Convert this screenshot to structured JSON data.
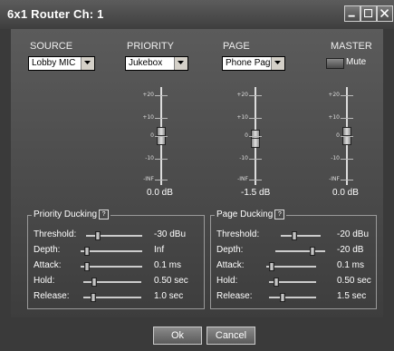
{
  "window": {
    "title": "6x1 Router   Ch: 1"
  },
  "sections": {
    "source": {
      "label": "SOURCE",
      "value": "Lobby MIC"
    },
    "priority": {
      "label": "PRIORITY",
      "value": "Jukebox"
    },
    "page": {
      "label": "PAGE",
      "value": "Phone Page"
    },
    "master": {
      "label": "MASTER",
      "mute_label": "Mute"
    }
  },
  "fader_scale": [
    "+20",
    "+10",
    "0",
    "-10",
    "-INF"
  ],
  "faders": {
    "priority": {
      "value_text": "0.0 dB",
      "db": 0.0
    },
    "page": {
      "value_text": "-1.5 dB",
      "db": -1.5
    },
    "master": {
      "value_text": "0.0 dB",
      "db": 0.0
    }
  },
  "priority_ducking": {
    "title": "Priority Ducking",
    "help_glyph": "?",
    "params": [
      {
        "label": "Threshold:",
        "value": "-30 dBu"
      },
      {
        "label": "Depth:",
        "value": "Inf"
      },
      {
        "label": "Attack:",
        "value": "0.1 ms"
      },
      {
        "label": "Hold:",
        "value": "0.50 sec"
      },
      {
        "label": "Release:",
        "value": "1.0 sec"
      }
    ]
  },
  "page_ducking": {
    "title": "Page Ducking",
    "help_glyph": "?",
    "params": [
      {
        "label": "Threshold:",
        "value": "-20 dBu"
      },
      {
        "label": "Depth:",
        "value": "-20 dB"
      },
      {
        "label": "Attack:",
        "value": "0.1 ms"
      },
      {
        "label": "Hold:",
        "value": "0.50 sec"
      },
      {
        "label": "Release:",
        "value": "1.5 sec"
      }
    ]
  },
  "buttons": {
    "ok": "Ok",
    "cancel": "Cancel"
  },
  "colors": {
    "panel_top": "#5b5b5b",
    "panel_bottom": "#3d3d3d",
    "frame": "#3a3a3a"
  }
}
